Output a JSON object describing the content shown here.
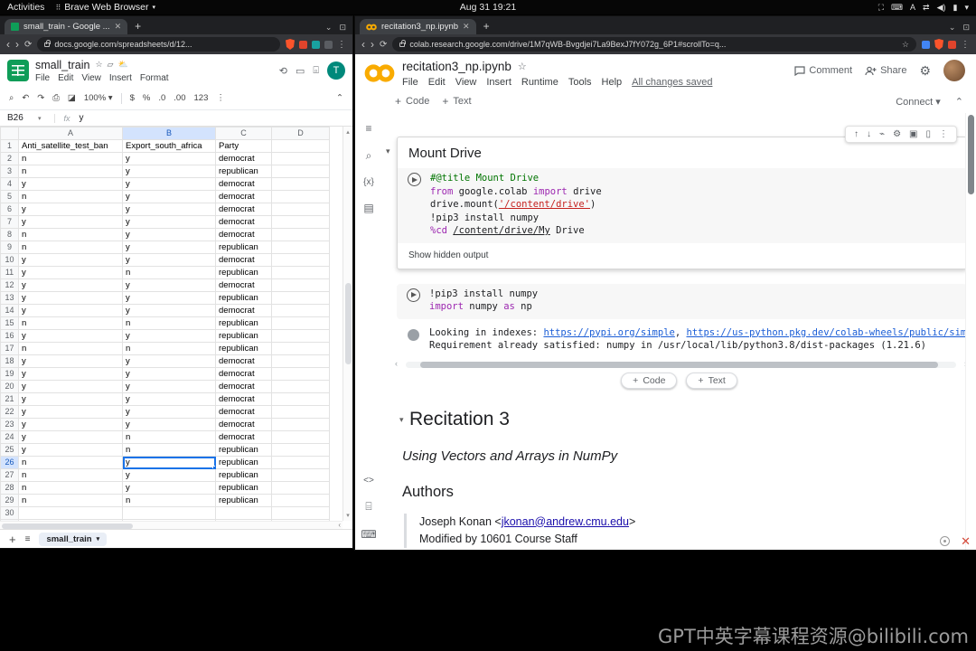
{
  "system_bar": {
    "activities_label": "Activities",
    "app_menu_label": "Brave Web Browser",
    "clock": "Aug 31 19:21",
    "tray_icons": [
      {
        "name": "screen-icon",
        "glyph": "⛶"
      },
      {
        "name": "keyboard-icon",
        "glyph": "⌨"
      },
      {
        "name": "input-language-icon",
        "glyph": "A"
      },
      {
        "name": "network-icon",
        "glyph": "⇄"
      },
      {
        "name": "volume-icon",
        "glyph": "◀)"
      },
      {
        "name": "battery-icon",
        "glyph": "▮"
      },
      {
        "name": "tray-dropdown-icon",
        "glyph": "▾"
      }
    ]
  },
  "icons": {
    "back": "‹",
    "forward": "›",
    "reload": "⟳",
    "close": "✕",
    "new_tab": "+",
    "more": "⋮",
    "dropdown": "▾",
    "chevron_up": "⌃",
    "star": "☆",
    "search": "⌕",
    "undo": "↶",
    "redo": "↷",
    "print": "⎙",
    "paint": "◪",
    "up": "↑",
    "down": "↓",
    "gear": "⚙",
    "link": "⌁",
    "copy": "▣",
    "delete": "▯",
    "menu": "≡",
    "history": "⟲",
    "comment": "▭",
    "camera": "⌻",
    "left": "‹",
    "collapse": "▾",
    "tab_search": "⌄",
    "code_snip": "&lt;&gt;"
  },
  "left_window": {
    "tab_title": "small_train - Google ...",
    "url": "docs.google.com/spreadsheets/d/12...",
    "sheets": {
      "doc_title": "small_train",
      "menu_items": [
        "File",
        "Edit",
        "View",
        "Insert",
        "Format"
      ],
      "toolbar": {
        "zoom": "100%",
        "currency": "$",
        "percent": "%",
        "dec_dec": ".0",
        "dec_inc": ".00",
        "fmt": "123"
      },
      "name_box": "B26",
      "fx_label": "fx",
      "formula_value": "y",
      "column_letters": [
        "A",
        "B",
        "C",
        "D"
      ],
      "header_row": [
        "Anti_satellite_test_ban",
        "Export_south_africa",
        "Party"
      ],
      "rows": [
        [
          "n",
          "y",
          "democrat"
        ],
        [
          "n",
          "y",
          "republican"
        ],
        [
          "y",
          "y",
          "democrat"
        ],
        [
          "n",
          "y",
          "democrat"
        ],
        [
          "y",
          "y",
          "democrat"
        ],
        [
          "y",
          "y",
          "democrat"
        ],
        [
          "n",
          "y",
          "democrat"
        ],
        [
          "n",
          "y",
          "republican"
        ],
        [
          "y",
          "y",
          "democrat"
        ],
        [
          "y",
          "n",
          "republican"
        ],
        [
          "y",
          "y",
          "democrat"
        ],
        [
          "y",
          "y",
          "republican"
        ],
        [
          "y",
          "y",
          "democrat"
        ],
        [
          "n",
          "n",
          "republican"
        ],
        [
          "y",
          "y",
          "republican"
        ],
        [
          "n",
          "n",
          "republican"
        ],
        [
          "y",
          "y",
          "democrat"
        ],
        [
          "y",
          "y",
          "democrat"
        ],
        [
          "y",
          "y",
          "democrat"
        ],
        [
          "y",
          "y",
          "democrat"
        ],
        [
          "y",
          "y",
          "democrat"
        ],
        [
          "y",
          "y",
          "democrat"
        ],
        [
          "y",
          "n",
          "democrat"
        ],
        [
          "y",
          "n",
          "republican"
        ],
        [
          "n",
          "y",
          "republican"
        ],
        [
          "n",
          "y",
          "republican"
        ],
        [
          "n",
          "y",
          "republican"
        ],
        [
          "n",
          "n",
          "republican"
        ]
      ],
      "total_rows": 32,
      "selected": {
        "row": 26,
        "col": 1,
        "label": "B26"
      },
      "sheet_tab_label": "small_train"
    }
  },
  "right_window": {
    "tab_title": "recitation3_np.ipynb",
    "url": "colab.research.google.com/drive/1M7qWB-Bvgdjei7La9BexJ7fY072g_6P1#scrollTo=q...",
    "colab": {
      "doc_title": "recitation3_np.ipynb",
      "menu_items": [
        "File",
        "Edit",
        "View",
        "Insert",
        "Runtime",
        "Tools",
        "Help"
      ],
      "saved_status": "All changes saved",
      "comment_label": "Comment",
      "share_label": "Share",
      "add_code_label": "Code",
      "add_text_label": "Text",
      "connect_label": "Connect",
      "section1_title": "Mount Drive",
      "cell1_lines": [
        [
          {
            "t": "#@title Mount Drive",
            "c": "com"
          }
        ],
        [
          {
            "t": "from",
            "c": "kw"
          },
          {
            "t": " google.colab ",
            "c": "pl"
          },
          {
            "t": "import",
            "c": "kw"
          },
          {
            "t": " drive",
            "c": "pl"
          }
        ],
        [
          {
            "t": "drive.mount(",
            "c": "pl"
          },
          {
            "t": "'/content/drive'",
            "c": "strlink"
          },
          {
            "t": ")",
            "c": "pl"
          }
        ],
        [
          {
            "t": "!pip3 install numpy",
            "c": "pl"
          }
        ],
        [
          {
            "t": "%cd ",
            "c": "mag"
          },
          {
            "t": "/content/drive/My",
            "c": "pathlink"
          },
          {
            "t": " Drive",
            "c": "pl"
          }
        ]
      ],
      "show_hidden_output": "Show hidden output",
      "cell2_lines": [
        [
          {
            "t": "!pip3 install numpy",
            "c": "pl"
          }
        ],
        [
          {
            "t": "import",
            "c": "kw"
          },
          {
            "t": " numpy ",
            "c": "pl"
          },
          {
            "t": "as",
            "c": "kw"
          },
          {
            "t": " np",
            "c": "pl"
          }
        ]
      ],
      "output_lines": [
        [
          {
            "t": "Looking in indexes: ",
            "c": "pl"
          },
          {
            "t": "https://pypi.org/simple",
            "c": "link"
          },
          {
            "t": ", ",
            "c": "pl"
          },
          {
            "t": "https://us-python.pkg.dev/colab-wheels/public/sim",
            "c": "link"
          }
        ],
        [
          {
            "t": "Requirement already satisfied: numpy in /usr/local/lib/python3.8/dist-packages (1.21.6)",
            "c": "pl"
          }
        ]
      ],
      "section2_title": "Recitation 3",
      "subtitle": "Using Vectors and Arrays in NumPy",
      "authors_title": "Authors",
      "author_prefix": "Joseph Konan <",
      "author_email": "jkonan@andrew.cmu.edu",
      "author_suffix": ">",
      "modified_line": "Modified by 10601 Course Staff"
    }
  },
  "watermark": "GPT中英字幕课程资源@bilibili.com"
}
